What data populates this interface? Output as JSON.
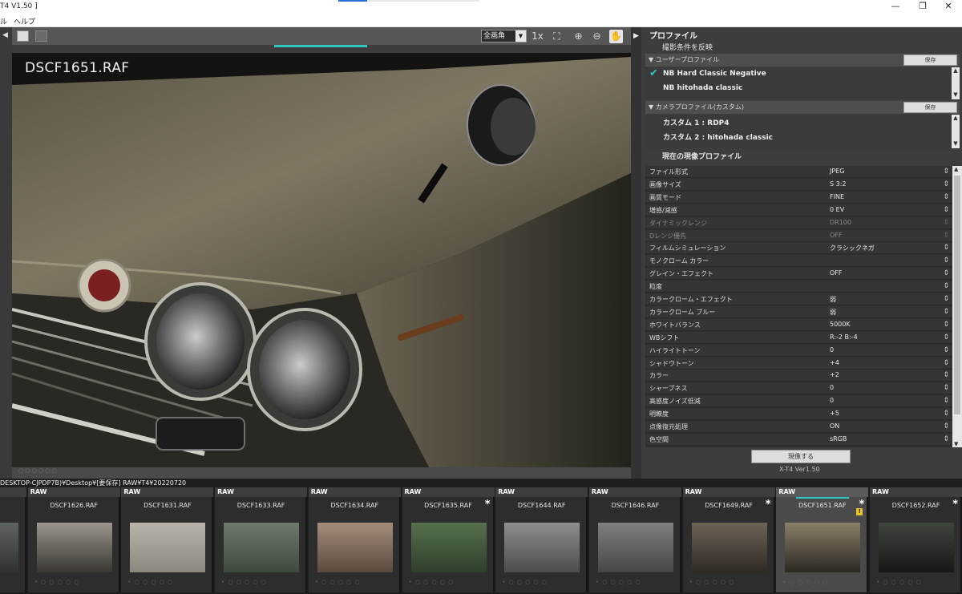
{
  "window": {
    "title": "T4  V1.50 ]",
    "controls": [
      "—",
      "❐",
      "✕"
    ]
  },
  "menu": {
    "items": [
      "ル",
      "ヘルプ"
    ]
  },
  "viewer": {
    "zoom_label": "全画角",
    "filename": "DSCF1651.RAF",
    "toolbar_icons": [
      "one-to-one-icon",
      "fit-screen-icon",
      "zoom-in-icon",
      "zoom-out-icon",
      "hand-tool-icon"
    ]
  },
  "panel": {
    "title": "プロファイル",
    "apply_shooting": "撮影条件を反映",
    "user_profile": {
      "header": "▼ ユーザープロファイル",
      "save_label": "保存",
      "items": [
        "NB Hard Classic Negative",
        "NB hitohada classic"
      ],
      "selected_index": 0
    },
    "camera_profile": {
      "header": "▼ カメラプロファイル(カスタム)",
      "save_label": "保存",
      "items": [
        {
          "label": "カスタム 1 :",
          "value": "RDP4"
        },
        {
          "label": "カスタム 2 :",
          "value": "hitohada classic"
        }
      ]
    },
    "current_profile": "現在の現像プロファイル",
    "params": [
      {
        "k": "ファイル形式",
        "v": "JPEG",
        "disabled": false
      },
      {
        "k": "画像サイズ",
        "v": "S 3:2",
        "disabled": false
      },
      {
        "k": "画質モード",
        "v": "FINE",
        "disabled": false
      },
      {
        "k": "増感/減感",
        "v": "0 EV",
        "disabled": false
      },
      {
        "k": "ダイナミックレンジ",
        "v": "DR100",
        "disabled": true
      },
      {
        "k": "Dレンジ優先",
        "v": "OFF",
        "disabled": true
      },
      {
        "k": "フィルムシミュレーション",
        "v": "クラシックネガ",
        "disabled": false
      },
      {
        "k": "モノクローム カラー",
        "v": "",
        "disabled": false
      },
      {
        "k": "グレイン・エフェクト",
        "v": "OFF",
        "disabled": false
      },
      {
        "k": "粒度",
        "v": "",
        "disabled": false
      },
      {
        "k": "カラークローム・エフェクト",
        "v": "弱",
        "disabled": false
      },
      {
        "k": "カラークローム ブルー",
        "v": "弱",
        "disabled": false
      },
      {
        "k": "ホワイトバランス",
        "v": "5000K",
        "disabled": false
      },
      {
        "k": "WBシフト",
        "v": "R:-2 B:-4",
        "disabled": false
      },
      {
        "k": "ハイライトトーン",
        "v": "0",
        "disabled": false
      },
      {
        "k": "シャドウトーン",
        "v": "+4",
        "disabled": false
      },
      {
        "k": "カラー",
        "v": "+2",
        "disabled": false
      },
      {
        "k": "シャープネス",
        "v": "0",
        "disabled": false
      },
      {
        "k": "高感度ノイズ低減",
        "v": "0",
        "disabled": false
      },
      {
        "k": "明瞭度",
        "v": "+5",
        "disabled": false
      },
      {
        "k": "点像復元処理",
        "v": "ON",
        "disabled": false
      },
      {
        "k": "色空間",
        "v": "sRGB",
        "disabled": false
      }
    ],
    "develop_button": "現像する",
    "version": "X-T4 Ver1.50"
  },
  "path": "DESKTOP-CJPDP7B)¥Desktop¥[要保存] RAW¥T4¥20220720",
  "filmstrip": {
    "raw_label": "RAW",
    "items": [
      {
        "name": "F",
        "starred": false,
        "selected": false,
        "warn": false
      },
      {
        "name": "DSCF1626.RAF",
        "starred": false,
        "selected": false,
        "warn": false
      },
      {
        "name": "DSCF1631.RAF",
        "starred": false,
        "selected": false,
        "warn": false
      },
      {
        "name": "DSCF1633.RAF",
        "starred": false,
        "selected": false,
        "warn": false
      },
      {
        "name": "DSCF1634.RAF",
        "starred": false,
        "selected": false,
        "warn": false
      },
      {
        "name": "DSCF1635.RAF",
        "starred": true,
        "selected": false,
        "warn": false
      },
      {
        "name": "DSCF1644.RAF",
        "starred": false,
        "selected": false,
        "warn": false
      },
      {
        "name": "DSCF1646.RAF",
        "starred": false,
        "selected": false,
        "warn": false
      },
      {
        "name": "DSCF1649.RAF",
        "starred": true,
        "selected": false,
        "warn": false
      },
      {
        "name": "DSCF1651.RAF",
        "starred": true,
        "selected": true,
        "warn": true
      },
      {
        "name": "DSCF1652.RAF",
        "starred": true,
        "selected": false,
        "warn": false
      }
    ]
  }
}
